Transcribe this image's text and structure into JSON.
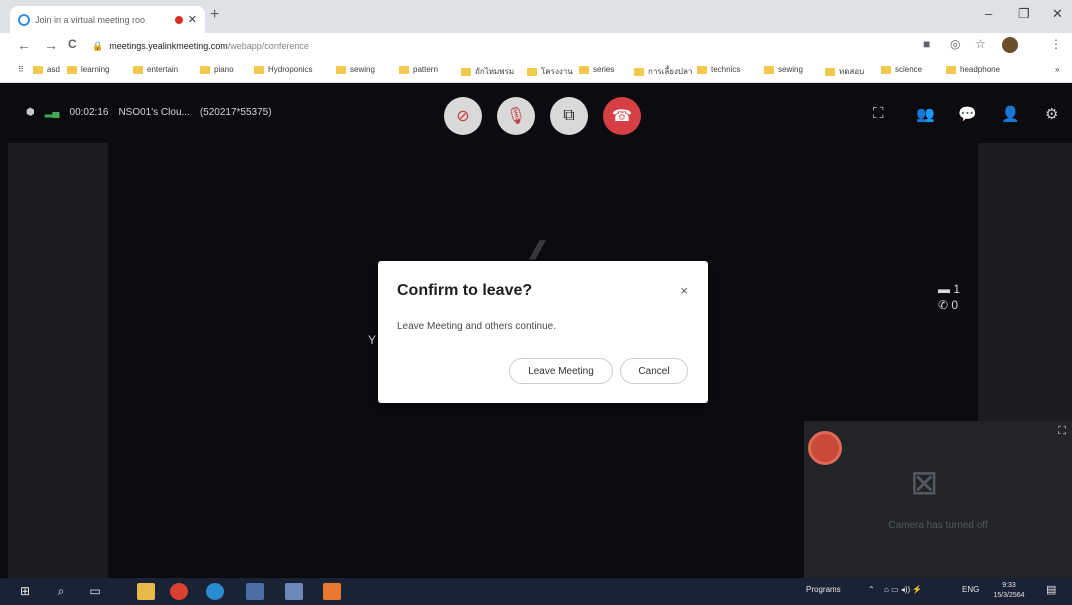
{
  "browser": {
    "tab_title": "Join in a virtual meeting roo",
    "tab_close": "✕",
    "new_tab": "+",
    "window_controls": [
      "–",
      "❐",
      "✕"
    ],
    "url_host": "meetings.yealinkmeeting.com",
    "url_path": "/webapp/conference",
    "nav": [
      "←",
      "→",
      "C"
    ],
    "bookmarks": [
      "asd",
      "learning",
      "entertain",
      "piano",
      "Hydroponics",
      "sewing",
      "pattern",
      "ถักไหมพรม",
      "โครงงาน",
      "series",
      "การเลี้ยงปลา",
      "technics",
      "sewing",
      "ทดสอบ",
      "science",
      "headphone"
    ],
    "bookmarks_more": "»"
  },
  "meeting": {
    "timer": "00:02:16",
    "meeting_name": "NSO01's Clou...",
    "meeting_id": "(520217*55375)",
    "video_count": "1",
    "audio_count": "0",
    "partial_text": "Y",
    "self_camera_text": "Camera has turned off"
  },
  "dialog": {
    "title": "Confirm to leave?",
    "message": "Leave Meeting and others continue.",
    "leave_button": "Leave Meeting",
    "cancel_button": "Cancel",
    "close": "×"
  },
  "taskbar": {
    "tray_label": "Programs",
    "lang": "ENG",
    "time": "9:33",
    "date": "15/3/2564"
  },
  "colors": {
    "app_bg": "#0b0b10",
    "hangup_red": "#d64045",
    "control_gray": "#d9d9d9",
    "taskbar_bg": "#1a2236"
  }
}
